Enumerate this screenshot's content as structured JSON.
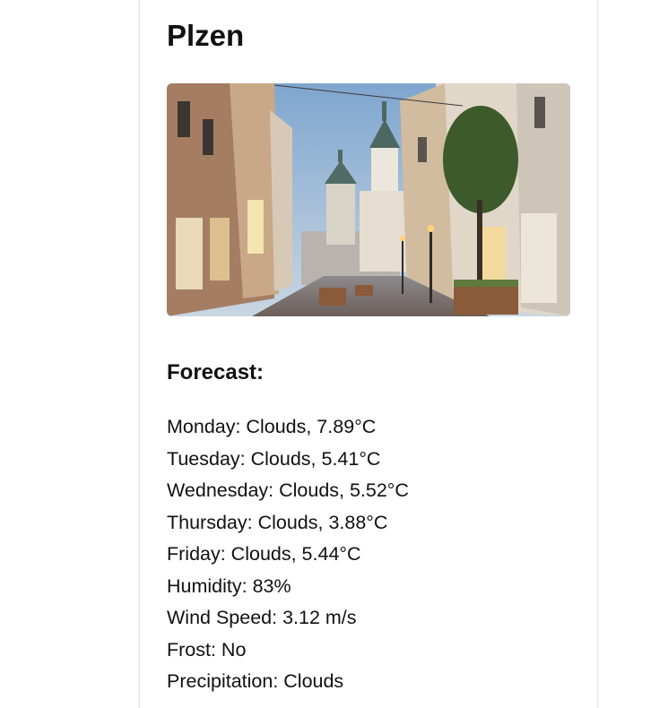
{
  "city": {
    "name": "Plzen"
  },
  "photo": {
    "alt": "Plzen"
  },
  "forecast": {
    "heading": "Forecast:",
    "items": [
      "Monday: Clouds, 7.89°C",
      "Tuesday: Clouds, 5.41°C",
      "Wednesday: Clouds, 5.52°C",
      "Thursday: Clouds, 3.88°C",
      "Friday: Clouds, 5.44°C",
      "Humidity: 83%",
      "Wind Speed: 3.12 m/s",
      "Frost: No",
      "Precipitation: Clouds"
    ]
  }
}
